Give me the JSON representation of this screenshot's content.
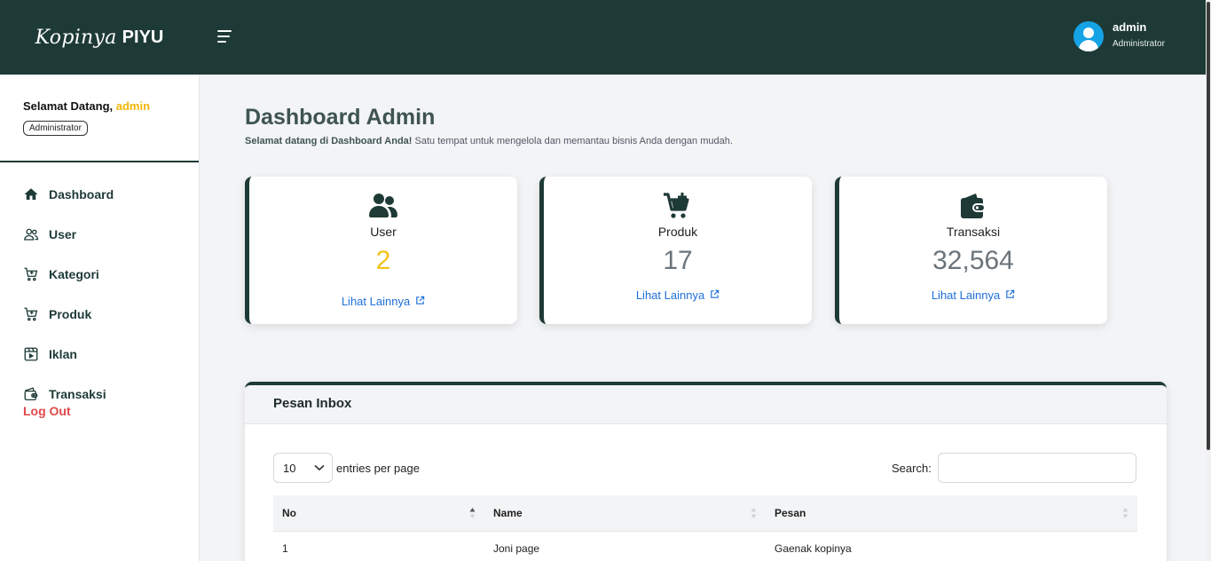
{
  "brand": {
    "script": "Kopinya",
    "bold": "PIYU"
  },
  "header": {
    "user_name": "admin",
    "user_role": "Administrator"
  },
  "sidebar": {
    "welcome_prefix": "Selamat Datang, ",
    "welcome_name": "admin",
    "role_badge": "Administrator",
    "items": [
      {
        "label": "Dashboard",
        "icon": "home-icon"
      },
      {
        "label": "User",
        "icon": "users-icon"
      },
      {
        "label": "Kategori",
        "icon": "cart-icon"
      },
      {
        "label": "Produk",
        "icon": "cart-icon"
      },
      {
        "label": "Iklan",
        "icon": "media-icon"
      },
      {
        "label": "Transaksi",
        "icon": "wallet-icon"
      }
    ],
    "logout": "Log Out"
  },
  "main": {
    "title": "Dashboard Admin",
    "subtitle_bold": "Selamat datang di Dashboard Anda!",
    "subtitle_rest": " Satu tempat untuk mengelola dan memantau bisnis Anda dengan mudah."
  },
  "cards": [
    {
      "label": "User",
      "value": "2",
      "link": "Lihat Lainnya",
      "icon": "users-icon",
      "value_color": "#f2c21b"
    },
    {
      "label": "Produk",
      "value": "17",
      "link": "Lihat Lainnya",
      "icon": "cart-plus-icon",
      "value_color": "#6b747a"
    },
    {
      "label": "Transaksi",
      "value": "32,564",
      "link": "Lihat Lainnya",
      "icon": "wallet-icon",
      "value_color": "#6b747a"
    }
  ],
  "inbox": {
    "title": "Pesan Inbox",
    "page_size": "10",
    "entries_label": "entries per page",
    "search_label": "Search:",
    "search_value": "",
    "columns": [
      "No",
      "Name",
      "Pesan"
    ],
    "rows": [
      [
        "1",
        "Joni page",
        "Gaenak kopinya"
      ]
    ]
  },
  "colors": {
    "primary": "#1e3a36",
    "accent": "#f2b705",
    "link": "#1e6fd9",
    "danger": "#e04848"
  }
}
